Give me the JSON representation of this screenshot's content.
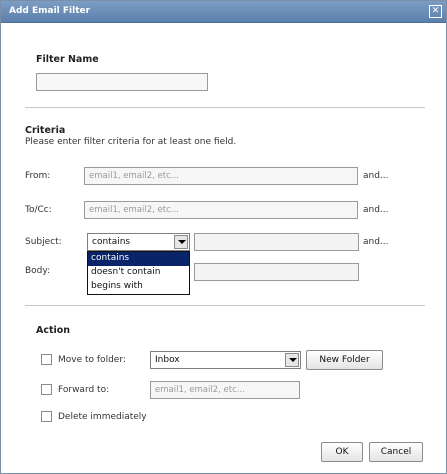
{
  "dialog": {
    "title": "Add Email Filter",
    "close_label": "✕"
  },
  "filter_name": {
    "title": "Filter Name",
    "value": ""
  },
  "criteria": {
    "title": "Criteria",
    "instructions": "Please enter filter criteria for at least one field.",
    "from": {
      "label": "From:",
      "placeholder": "email1, email2, etc...",
      "suffix": "and..."
    },
    "to_cc": {
      "label": "To/Cc:",
      "placeholder": "email1, email2, etc...",
      "suffix": "and..."
    },
    "subject": {
      "label": "Subject:",
      "operator": "contains",
      "value": "",
      "suffix": "and..."
    },
    "body": {
      "label": "Body:",
      "value": ""
    },
    "operator_options": [
      "contains",
      "doesn't contain",
      "begins with"
    ]
  },
  "action": {
    "title": "Action",
    "move_to_folder": {
      "label": "Move to folder:",
      "folder": "Inbox",
      "new_folder_label": "New Folder",
      "checked": false
    },
    "forward_to": {
      "label": "Forward to:",
      "placeholder": "email1, email2, etc...",
      "checked": false
    },
    "delete_immediately": {
      "label": "Delete immediately",
      "checked": false
    }
  },
  "footer": {
    "ok_label": "OK",
    "cancel_label": "Cancel"
  }
}
